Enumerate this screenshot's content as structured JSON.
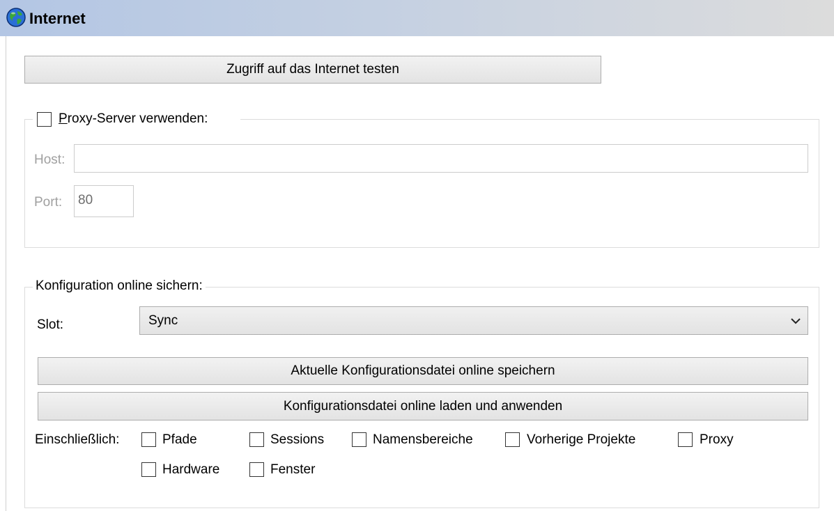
{
  "header": {
    "title": "Internet",
    "icon": "globe-icon"
  },
  "test_button": {
    "label": "Zugriff auf das Internet testen"
  },
  "proxy": {
    "checkbox_label": "Proxy-Server verwenden:",
    "checked": false,
    "host_label": "Host:",
    "host_value": "",
    "port_label": "Port:",
    "port_value": "80"
  },
  "sync": {
    "group_label": "Konfiguration online sichern:",
    "slot_label": "Slot:",
    "slot_value": "Sync",
    "save_button": "Aktuelle Konfigurationsdatei online speichern",
    "load_button": "Konfigurationsdatei online laden und anwenden",
    "include_label": "Einschließlich:",
    "options": [
      {
        "label": "Pfade",
        "checked": false
      },
      {
        "label": "Sessions",
        "checked": false
      },
      {
        "label": "Namensbereiche",
        "checked": false
      },
      {
        "label": "Vorherige Projekte",
        "checked": false
      },
      {
        "label": "Proxy",
        "checked": false
      },
      {
        "label": "Hardware",
        "checked": false
      },
      {
        "label": "Fenster",
        "checked": false
      }
    ]
  },
  "colors": {
    "header_start": "#b3c6e4",
    "header_end": "#dcdcdc",
    "button_bg": "#e6e6e6",
    "disabled_text": "#a0a0a0"
  }
}
